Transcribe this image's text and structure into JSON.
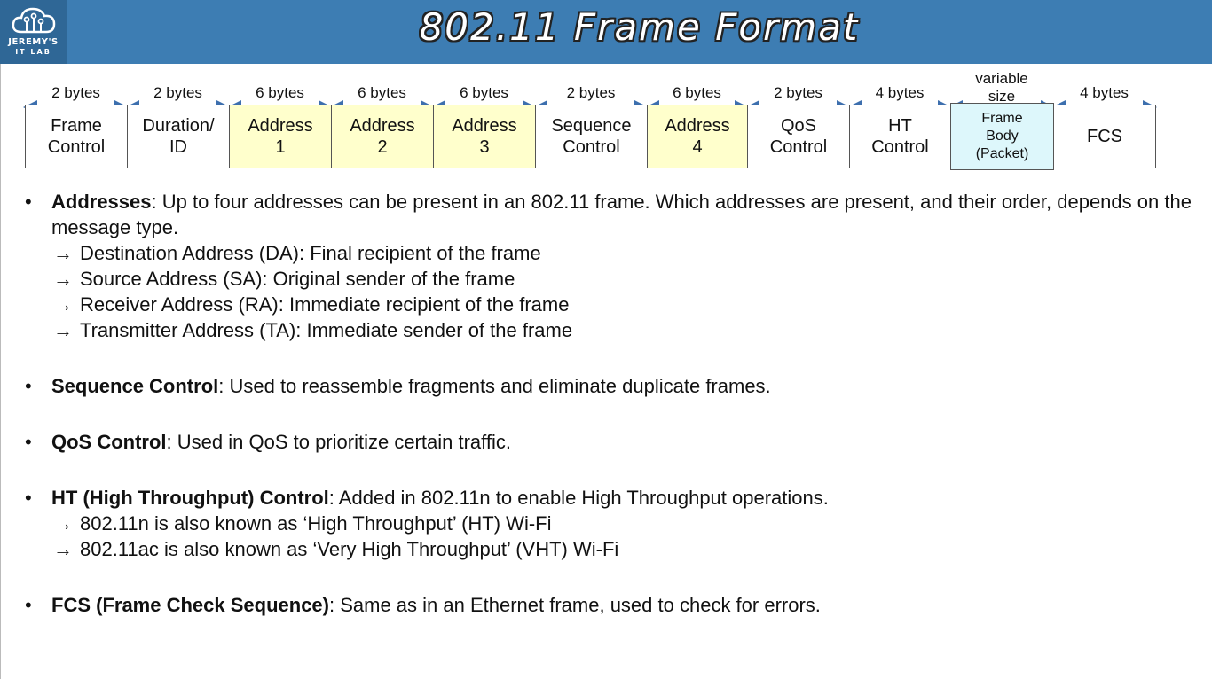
{
  "header": {
    "title": "802.11 Frame Format",
    "logo_line1": "JEREMY'S",
    "logo_line2": "IT LAB",
    "bar_color": "#3d7db3"
  },
  "frame_fields": [
    {
      "size": "2 bytes",
      "label": "Frame\nControl",
      "color": "#ffffff"
    },
    {
      "size": "2 bytes",
      "label": "Duration/\nID",
      "color": "#ffffff"
    },
    {
      "size": "6 bytes",
      "label": "Address\n1",
      "color": "#ffffcc"
    },
    {
      "size": "6 bytes",
      "label": "Address\n2",
      "color": "#ffffcc"
    },
    {
      "size": "6 bytes",
      "label": "Address\n3",
      "color": "#ffffcc"
    },
    {
      "size": "2 bytes",
      "label": "Sequence\nControl",
      "color": "#ffffff"
    },
    {
      "size": "6 bytes",
      "label": "Address\n4",
      "color": "#ffffcc"
    },
    {
      "size": "2 bytes",
      "label": "QoS\nControl",
      "color": "#ffffff"
    },
    {
      "size": "4 bytes",
      "label": "HT\nControl",
      "color": "#ffffff"
    },
    {
      "size": "variable\nsize",
      "label": "Frame\nBody\n(Packet)",
      "color": "#ddf7fb"
    },
    {
      "size": "4 bytes",
      "label": "FCS",
      "color": "#ffffff"
    }
  ],
  "bullets": {
    "b1_bold": "Addresses",
    "b1_text": ": Up to four addresses can be present in an 802.11 frame.  Which addresses are present, and their order, depends on the message type.",
    "b1_subs": [
      "Destination Address (DA): Final recipient of the frame",
      "Source Address (SA): Original sender of the frame",
      "Receiver Address (RA): Immediate recipient of the frame",
      "Transmitter Address (TA): Immediate sender of the frame"
    ],
    "b2_bold": "Sequence Control",
    "b2_text": ": Used to reassemble fragments and eliminate duplicate frames.",
    "b3_bold": "QoS Control",
    "b3_text": ": Used in QoS to prioritize certain traffic.",
    "b4_bold": "HT (High Throughput) Control",
    "b4_text": ": Added in 802.11n to enable High Throughput operations.",
    "b4_subs": [
      "802.11n is also known as ‘High Throughput’ (HT) Wi-Fi",
      "802.11ac is also known as ‘Very High Throughput’ (VHT) Wi-Fi"
    ],
    "b5_bold": "FCS (Frame Check Sequence)",
    "b5_text": ": Same as in an Ethernet frame, used to check for errors.",
    "bullet_glyph": "•",
    "arrow_glyph": "→"
  }
}
